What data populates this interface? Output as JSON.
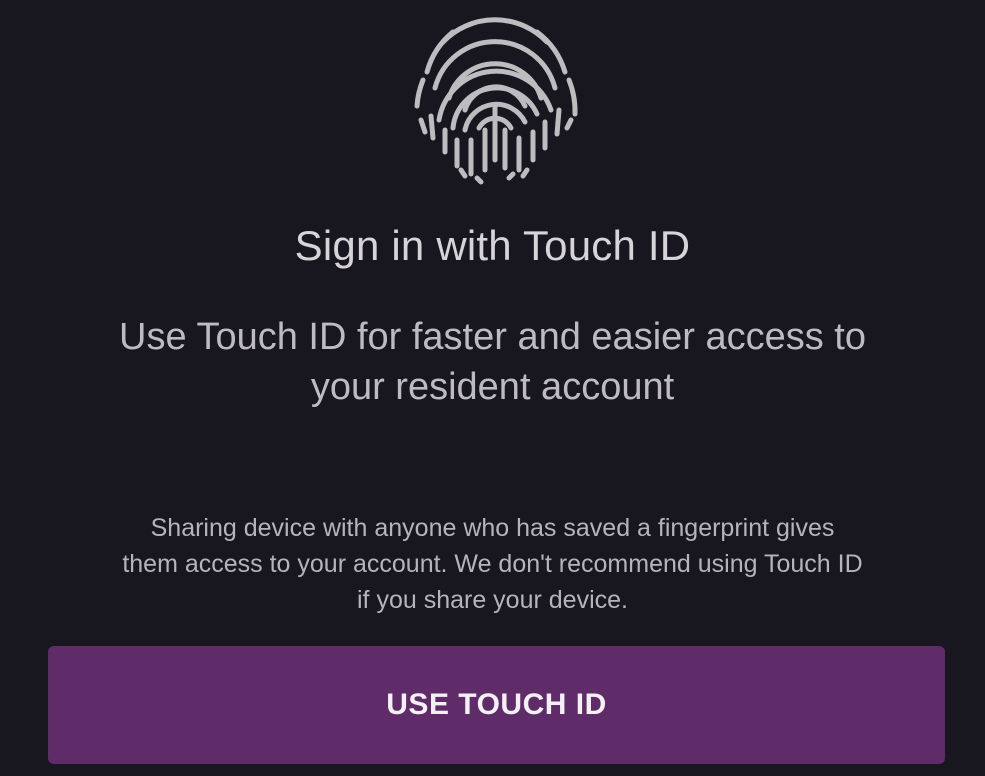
{
  "touch_id": {
    "icon": "fingerprint-icon",
    "title": "Sign in with Touch ID",
    "subtitle_line1": "Use Touch ID for faster and easier access to",
    "subtitle_line2": "your resident account",
    "warning_line1": "Sharing device with anyone who has saved a fingerprint gives",
    "warning_line2": "them access to your account. We don't recommend using Touch ID",
    "warning_line3": "if you share your device.",
    "button_label": "USE TOUCH ID"
  },
  "colors": {
    "background": "#18171f",
    "accent": "#5f2c69",
    "text_primary": "#d6d4d9",
    "text_secondary": "#bdbbc1"
  }
}
